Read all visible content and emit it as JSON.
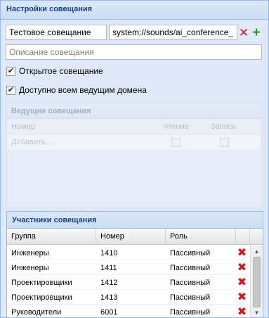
{
  "panel": {
    "title": "Настройки совещания"
  },
  "form": {
    "name_value": "Тестовое совещание",
    "sound_value": "system://sounds/ai_conference_",
    "description_placeholder": "Описание совещания"
  },
  "checks": {
    "open_label": "Открытое совещание",
    "domain_label": "Доступно всем ведущим домена"
  },
  "leading": {
    "title": "Ведущие совещания",
    "columns": [
      "Номер",
      "Чтение",
      "Запись"
    ],
    "add_label": "Добавить..."
  },
  "participants": {
    "title": "Участники совещания",
    "columns": [
      "Группа",
      "Номер",
      "Роль"
    ],
    "rows": [
      {
        "group": "Инженеры",
        "number": "1410",
        "role": "Пассивный"
      },
      {
        "group": "Инженеры",
        "number": "1411",
        "role": "Пассивный"
      },
      {
        "group": "Проектировщики",
        "number": "1412",
        "role": "Пассивный"
      },
      {
        "group": "Проектировщики",
        "number": "1413",
        "role": "Пассивный"
      },
      {
        "group": "Руководители",
        "number": "6001",
        "role": "Пассивный"
      }
    ]
  },
  "icons": {
    "delete": "red-x-icon",
    "add": "green-plus-icon",
    "check": "checkmark-icon"
  },
  "colors": {
    "header_text": "#15428b",
    "delete_red": "#d0161a",
    "add_green": "#1c9b1c",
    "border": "#99bbe8"
  }
}
